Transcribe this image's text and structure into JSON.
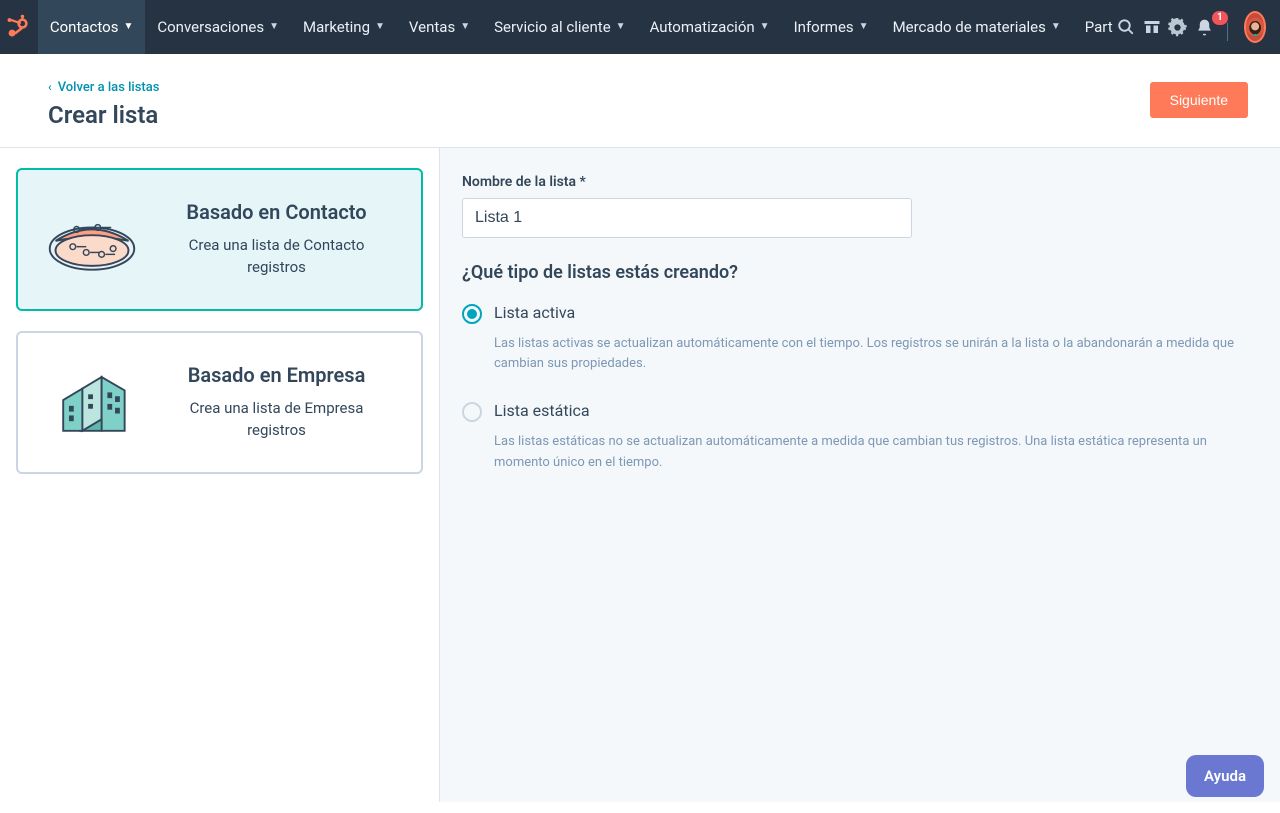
{
  "nav": {
    "items": [
      {
        "label": "Contactos",
        "active": true
      },
      {
        "label": "Conversaciones"
      },
      {
        "label": "Marketing"
      },
      {
        "label": "Ventas"
      },
      {
        "label": "Servicio al cliente"
      },
      {
        "label": "Automatización"
      },
      {
        "label": "Informes"
      },
      {
        "label": "Mercado de materiales"
      }
    ],
    "truncated": "Part",
    "notification_count": "1"
  },
  "header": {
    "back": "Volver a las listas",
    "title": "Crear lista",
    "next": "Siguiente"
  },
  "cards": [
    {
      "title": "Basado en Contacto",
      "desc": "Crea una lista de Contacto registros",
      "selected": true
    },
    {
      "title": "Basado en Empresa",
      "desc": "Crea una lista de Empresa registros",
      "selected": false
    }
  ],
  "form": {
    "name_label": "Nombre de la lista *",
    "name_value": "Lista 1",
    "type_question": "¿Qué tipo de listas estás creando?",
    "options": [
      {
        "title": "Lista activa",
        "desc": "Las listas activas se actualizan automáticamente con el tiempo. Los registros se unirán a la lista o la abandonarán a medida que cambian sus propiedades.",
        "checked": true
      },
      {
        "title": "Lista estática",
        "desc": "Las listas estáticas no se actualizan automáticamente a medida que cambian tus registros. Una lista estática representa un momento único en el tiempo.",
        "checked": false
      }
    ]
  },
  "help": {
    "label": "Ayuda"
  }
}
